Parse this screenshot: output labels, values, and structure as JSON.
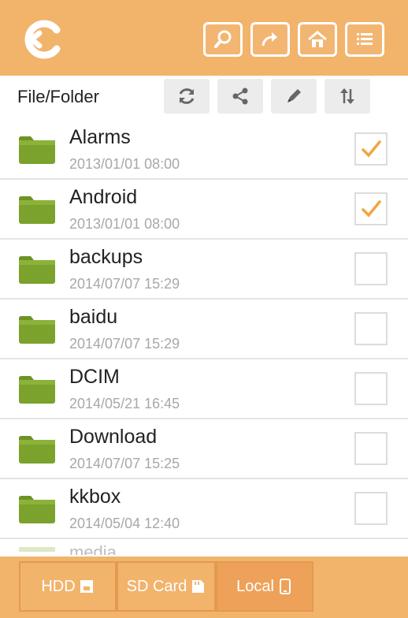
{
  "header": {
    "logo_icon": "c-back-logo-icon",
    "actions": [
      {
        "icon": "search-icon"
      },
      {
        "icon": "share-arrow-icon"
      },
      {
        "icon": "home-icon"
      },
      {
        "icon": "list-menu-icon"
      }
    ]
  },
  "toolbar": {
    "label": "File/Folder",
    "actions": [
      {
        "icon": "refresh-icon"
      },
      {
        "icon": "share-nodes-icon"
      },
      {
        "icon": "pencil-icon"
      },
      {
        "icon": "sort-icon"
      }
    ]
  },
  "files": [
    {
      "name": "Alarms",
      "date": "2013/01/01 08:00",
      "checked": true
    },
    {
      "name": "Android",
      "date": "2013/01/01 08:00",
      "checked": true
    },
    {
      "name": "backups",
      "date": "2014/07/07 15:29",
      "checked": false
    },
    {
      "name": "baidu",
      "date": "2014/07/07 15:29",
      "checked": false
    },
    {
      "name": "DCIM",
      "date": "2014/05/21 16:45",
      "checked": false
    },
    {
      "name": "Download",
      "date": "2014/07/07 15:25",
      "checked": false
    },
    {
      "name": "kkbox",
      "date": "2014/05/04 12:40",
      "checked": false
    }
  ],
  "partial_item": "media",
  "bottom_tabs": [
    {
      "label": "HDD",
      "active": false
    },
    {
      "label": "SD Card",
      "active": false
    },
    {
      "label": "Local",
      "active": true
    }
  ],
  "colors": {
    "accent": "#f2b36b",
    "check": "#f0a640",
    "folder": "#7aa22c"
  }
}
